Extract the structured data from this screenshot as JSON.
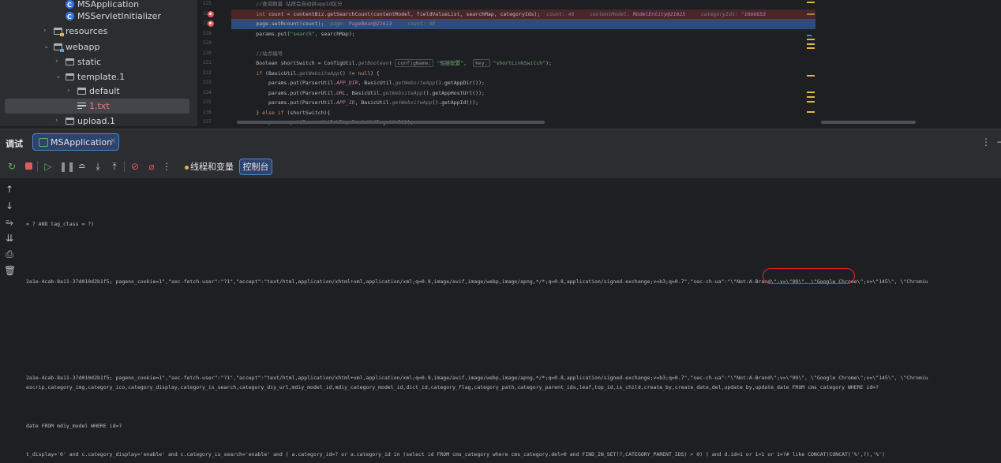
{
  "project_tree": {
    "items": [
      {
        "label": "MSApplication",
        "icon": "class-icon",
        "indent": 2,
        "chevron": ""
      },
      {
        "label": "MSServletInitializer",
        "icon": "class-icon",
        "indent": 2,
        "chevron": ""
      },
      {
        "label": "resources",
        "icon": "resources-folder-icon",
        "indent": 1,
        "chevron": "›"
      },
      {
        "label": "webapp",
        "icon": "web-folder-icon",
        "indent": 1,
        "chevron": "⌄"
      },
      {
        "label": "static",
        "icon": "folder-icon",
        "indent": 2,
        "chevron": "›"
      },
      {
        "label": "template.1",
        "icon": "folder-icon",
        "indent": 2,
        "chevron": "⌄"
      },
      {
        "label": "default",
        "icon": "folder-icon",
        "indent": 3,
        "chevron": "›"
      },
      {
        "label": "1.txt",
        "icon": "text-file-icon",
        "indent": 3,
        "chevron": "",
        "selected": true
      },
      {
        "label": "upload.1",
        "icon": "folder-icon",
        "indent": 2,
        "chevron": "›"
      }
    ]
  },
  "editor": {
    "line_numbers": [
      "225",
      "226",
      "227",
      "228",
      "229",
      "230",
      "231",
      "232",
      "233",
      "234",
      "235",
      "236",
      "237"
    ],
    "breakpoint_lines": [
      1,
      2
    ],
    "lines": [
      {
        "highlight": "",
        "parts": [
          {
            "c": "cmt",
            "t": "        //查询数量 站群会自动拼appId区分"
          }
        ]
      },
      {
        "highlight": "red",
        "parts": [
          {
            "c": "kw",
            "t": "        int "
          },
          {
            "c": "",
            "t": "count = contentBiz.getSearchCount(contentModel, fieldValueList, searchMap, categoryIds);"
          },
          {
            "c": "hint",
            "t": "  count: "
          },
          {
            "c": "hint",
            "t": "48"
          },
          {
            "c": "hint",
            "t": "     contentModel: "
          },
          {
            "c": "hint-v",
            "t": "ModelEntity@21625"
          },
          {
            "c": "hint",
            "t": "     categoryIds: "
          },
          {
            "c": "hint-v",
            "t": "\"1666653"
          }
        ]
      },
      {
        "highlight": "blue",
        "parts": [
          {
            "c": "",
            "t": "        page.setRcount(count);"
          },
          {
            "c": "hint",
            "t": "  page: "
          },
          {
            "c": "hint-v",
            "t": "PageBean@21613"
          },
          {
            "c": "hint",
            "t": "     count: "
          },
          {
            "c": "hint",
            "t": "48"
          }
        ]
      },
      {
        "highlight": "",
        "parts": [
          {
            "c": "",
            "t": "        params.put("
          },
          {
            "c": "str",
            "t": "\"search\""
          },
          {
            "c": "",
            "t": ", searchMap);"
          }
        ]
      },
      {
        "highlight": "",
        "parts": [
          {
            "c": "",
            "t": ""
          }
        ]
      },
      {
        "highlight": "",
        "parts": [
          {
            "c": "cmt",
            "t": "        //站点编号"
          }
        ]
      },
      {
        "highlight": "",
        "parts": [
          {
            "c": "",
            "t": "        Boolean shortSwitch = ConfigUtil."
          },
          {
            "c": "hint",
            "t": "getBoolean"
          },
          {
            "c": "",
            "t": "( "
          },
          {
            "c": "hintbox",
            "t": "configName:"
          },
          {
            "c": "str",
            "t": " \"短链配置\""
          },
          {
            "c": "",
            "t": ",  "
          },
          {
            "c": "hintbox",
            "t": "key:"
          },
          {
            "c": "str",
            "t": " \"shortLinkSwitch\""
          },
          {
            "c": "",
            "t": ");"
          }
        ]
      },
      {
        "highlight": "",
        "parts": [
          {
            "c": "kw",
            "t": "        if "
          },
          {
            "c": "",
            "t": "(BasicUtil."
          },
          {
            "c": "hint",
            "t": "getWebsiteApp"
          },
          {
            "c": "",
            "t": "() != "
          },
          {
            "c": "kw",
            "t": "null"
          },
          {
            "c": "",
            "t": ") {"
          }
        ]
      },
      {
        "highlight": "",
        "parts": [
          {
            "c": "",
            "t": "            params.put(ParserUtil."
          },
          {
            "c": "fld",
            "t": "APP_DIR"
          },
          {
            "c": "",
            "t": ", BasicUtil."
          },
          {
            "c": "hint",
            "t": "getWebsiteApp"
          },
          {
            "c": "",
            "t": "().getAppDir());"
          }
        ]
      },
      {
        "highlight": "",
        "parts": [
          {
            "c": "",
            "t": "            params.put(ParserUtil."
          },
          {
            "c": "fld",
            "t": "URL"
          },
          {
            "c": "",
            "t": ", BasicUtil."
          },
          {
            "c": "hint",
            "t": "getWebsiteApp"
          },
          {
            "c": "",
            "t": "().getAppHostUrl());"
          }
        ]
      },
      {
        "highlight": "",
        "parts": [
          {
            "c": "",
            "t": "            params.put(ParserUtil."
          },
          {
            "c": "fld",
            "t": "APP_ID"
          },
          {
            "c": "",
            "t": ", BasicUtil."
          },
          {
            "c": "hint",
            "t": "getWebsiteApp"
          },
          {
            "c": "",
            "t": "().getAppId());"
          }
        ]
      },
      {
        "highlight": "",
        "parts": [
          {
            "c": "",
            "t": "        } "
          },
          {
            "c": "kw",
            "t": "else if "
          },
          {
            "c": "",
            "t": "(shortSwitch){"
          }
        ]
      },
      {
        "highlight": "",
        "parts": [
          {
            "c": "",
            "t": "            params.put(ParserUtil.URL, BasicUtil.getUrl());"
          }
        ]
      }
    ]
  },
  "debug": {
    "title": "调试",
    "run_tab_label": "MSApplication",
    "close_glyph": "×",
    "menu_glyph": "⋮",
    "minimize_glyph": "−",
    "tabs": {
      "threads": "线程和变量",
      "console": "控制台"
    },
    "toolbar_icons": [
      "rerun-icon",
      "stop-icon",
      "resume-icon",
      "pause-icon",
      "step-over-icon",
      "step-into-icon",
      "step-out-icon",
      "view-breakpoints-icon",
      "mute-breakpoints-icon",
      "more-icon"
    ]
  },
  "console": {
    "lines": [
      {
        "row": 4,
        "text": "= ? AND tag_class = ?)"
      },
      {
        "row": 10,
        "text": "2a1e-4cab-8a11-37d010d2b1f5; pageno_cookie=1\",\"sec-fetch-user\":\"?1\",\"accept\":\"text/html,application/xhtml+xml,application/xml;q=0.9,image/avif,image/webp,image/apng,*/*;q=0.8,application/signed-exchange;v=b3;q=0.7\",\"sec-ch-ua\":\"\\\"Not:A-Brand\\\";v=\\\"99\\\", \\\"Google Chrome\\\";v=\\\"145\\\", \\\"Chromiu"
      },
      {
        "row": 20,
        "text": "2a1e-4cab-8a11-37d010d2b1f5; pageno_cookie=1\",\"sec-fetch-user\":\"?1\",\"accept\":\"text/html,application/xhtml+xml,application/xml;q=0.9,image/avif,image/webp,image/apng,*/*;q=0.8,application/signed-exchange;v=b3;q=0.7\",\"sec-ch-ua\":\"\\\"Not:A-Brand\\\";v=\\\"99\\\", \\\"Google Chrome\\\";v=\\\"145\\\", \\\"Chromiu"
      },
      {
        "row": 21,
        "text": "escrip,category_img,category_ico,category_display,category_is_search,category_diy_url,mdiy_model_id,mdiy_category_model_id,dict_id,category_flag,category_path,category_parent_ids,leaf,top_id,is_child,create_by,create_date,del,update_by,update_date FROM cms_category WHERE id=?"
      },
      {
        "row": 25,
        "text": "date FROM mdiy_model WHERE id=?"
      },
      {
        "row": 28,
        "text": "t_display='0' and c.category_display='enable' and c.category_is_search='enable' and ( a.category_id=? or a.category_id in (select id FROM cms_category where cms_category.del=0 and FIND_IN_SET(?,CATEGORY_PARENT_IDS) > 0) ) and d.id=1 or 1=1 or 1=?# like CONCAT(CONCAT('%',?),'%')"
      }
    ]
  }
}
